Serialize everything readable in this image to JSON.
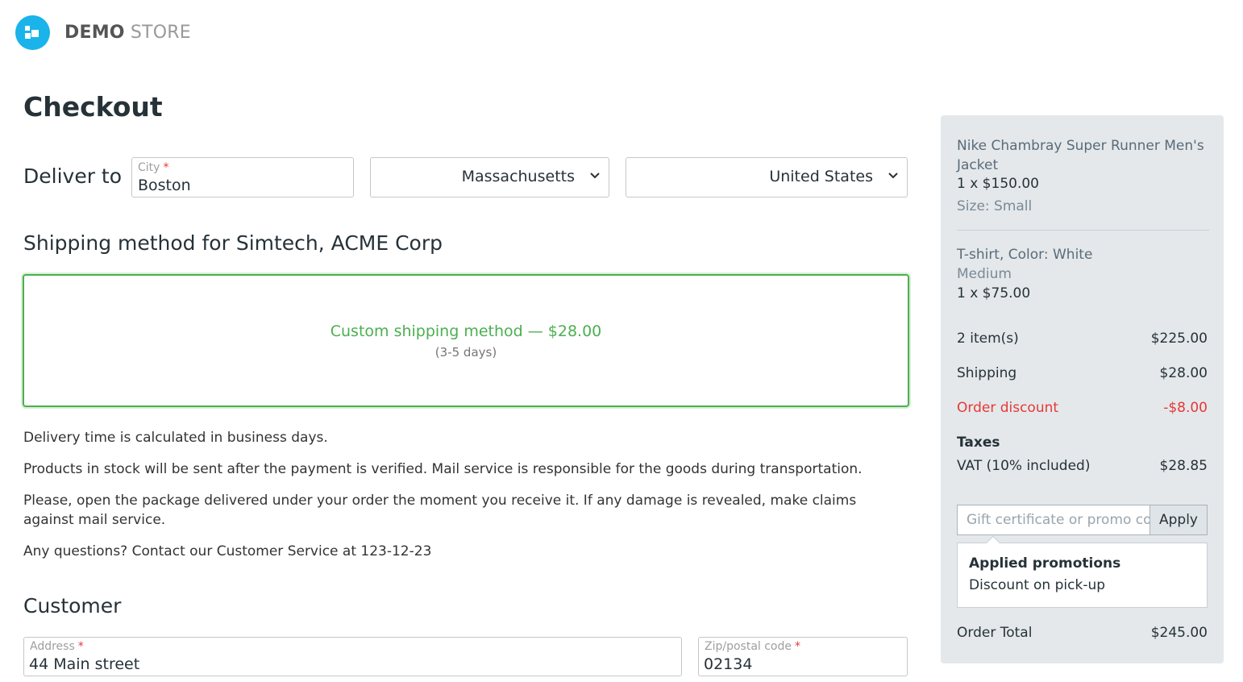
{
  "header": {
    "logo_bold": "DEMO",
    "logo_light": "STORE",
    "brand_color": "#1ab3ea"
  },
  "page": {
    "title": "Checkout"
  },
  "delivery": {
    "label": "Deliver to",
    "city_label": "City",
    "city_required": "*",
    "city_value": "Boston",
    "state_value": "Massachusetts",
    "country_value": "United States"
  },
  "shipping": {
    "title": "Shipping method for Simtech, ACME Corp",
    "method_name": "Custom shipping method — $28.00",
    "method_days": "(3-5 days)",
    "selected_color": "#4caf50"
  },
  "info": {
    "line1": "Delivery time is calculated in business days.",
    "line2": "Products in stock will be sent after the payment is verified. Mail service is responsible for the goods during transportation.",
    "line3": "Please, open the package delivered under your order the moment you receive it. If any damage is revealed, make claims against mail service.",
    "line4": "Any questions? Contact our Customer Service at 123-12-23"
  },
  "customer": {
    "title": "Customer",
    "address_label": "Address",
    "address_required": "*",
    "address_value": "44 Main street",
    "zip_label": "Zip/postal code",
    "zip_required": "*",
    "zip_value": "02134"
  },
  "summary": {
    "items": [
      {
        "name": "Nike Chambray Super Runner Men's Jacket",
        "qty": "1 x $150.00",
        "option": "Size: Small"
      },
      {
        "name": "T-shirt, Color: White",
        "option": "Medium",
        "qty": "1 x $75.00"
      }
    ],
    "subtotal_label": "2 item(s)",
    "subtotal_value": "$225.00",
    "shipping_label": "Shipping",
    "shipping_value": "$28.00",
    "discount_label": "Order discount",
    "discount_value": "-$8.00",
    "taxes_title": "Taxes",
    "vat_label": "VAT (10% included)",
    "vat_value": "$28.85",
    "promo_placeholder": "Gift certificate or promo code",
    "apply_label": "Apply",
    "applied_title": "Applied promotions",
    "applied_item": "Discount on pick-up",
    "total_label": "Order Total",
    "total_value": "$245.00",
    "discount_color": "#e53935"
  }
}
